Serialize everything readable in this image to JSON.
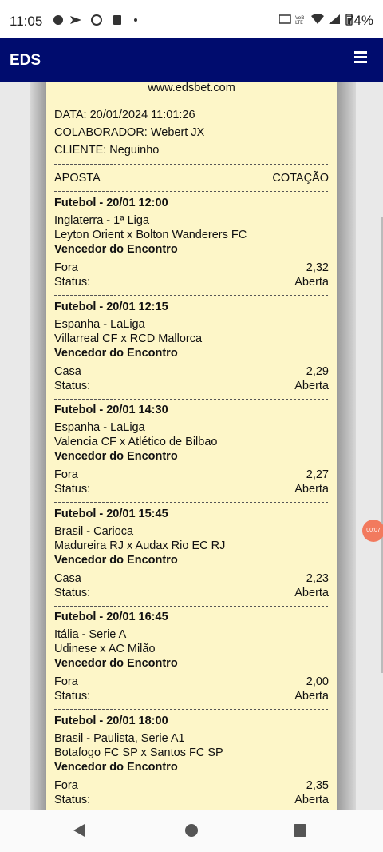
{
  "status_bar": {
    "time": "11:05",
    "battery": "74%"
  },
  "app": {
    "title": "EDS"
  },
  "receipt": {
    "site": "www.edsbet.com",
    "data": "DATA: 20/01/2024 11:01:26",
    "colaborador": "COLABORADOR: Webert JX",
    "cliente": "CLIENTE: Neguinho",
    "col_aposta": "APOSTA",
    "col_cotacao": "COTAÇÃO",
    "bets": [
      {
        "header": "Futebol - 20/01 12:00",
        "league": "Inglaterra - 1ª Liga",
        "match": "Leyton Orient x Bolton Wanderers FC",
        "market": "Vencedor do Encontro",
        "pick": "Fora",
        "odd": "2,32",
        "status_label": "Status:",
        "status": "Aberta"
      },
      {
        "header": "Futebol - 20/01 12:15",
        "league": "Espanha - LaLiga",
        "match": "Villarreal CF x RCD Mallorca",
        "market": "Vencedor do Encontro",
        "pick": "Casa",
        "odd": "2,29",
        "status_label": "Status:",
        "status": "Aberta"
      },
      {
        "header": "Futebol - 20/01 14:30",
        "league": "Espanha - LaLiga",
        "match": "Valencia CF x Atlético de Bilbao",
        "market": "Vencedor do Encontro",
        "pick": "Fora",
        "odd": "2,27",
        "status_label": "Status:",
        "status": "Aberta"
      },
      {
        "header": "Futebol - 20/01 15:45",
        "league": "Brasil - Carioca",
        "match": "Madureira RJ x Audax Rio EC RJ",
        "market": "Vencedor do Encontro",
        "pick": "Casa",
        "odd": "2,23",
        "status_label": "Status:",
        "status": "Aberta"
      },
      {
        "header": "Futebol - 20/01 16:45",
        "league": "Itália - Serie A",
        "match": "Udinese x AC Milão",
        "market": "Vencedor do Encontro",
        "pick": "Fora",
        "odd": "2,00",
        "status_label": "Status:",
        "status": "Aberta"
      },
      {
        "header": "Futebol - 20/01 18:00",
        "league": "Brasil - Paulista, Serie A1",
        "match": "Botafogo FC SP x Santos FC SP",
        "market": "Vencedor do Encontro",
        "pick": "Fora",
        "odd": "2,35",
        "status_label": "Status:",
        "status": "Aberta"
      }
    ]
  },
  "recording_timer": "00:07"
}
